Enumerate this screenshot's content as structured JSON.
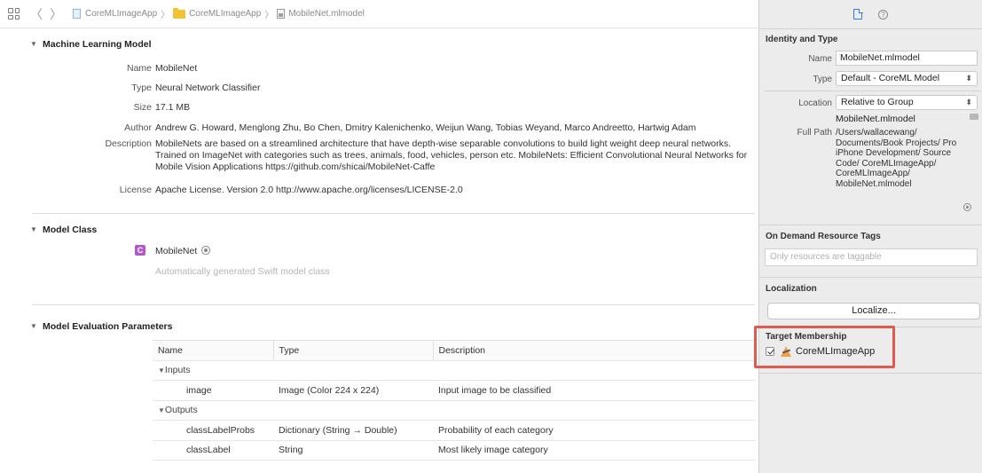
{
  "breadcrumb": {
    "items": [
      "CoreMLImageApp",
      "CoreMLImageApp",
      "MobileNet.mlmodel"
    ],
    "separator": "〉"
  },
  "nav": {
    "back": "〈",
    "forward": "〉"
  },
  "sections": {
    "machine_learning_model": {
      "title": "Machine Learning Model",
      "properties": [
        {
          "label": "Name",
          "value": "MobileNet"
        },
        {
          "label": "Type",
          "value": "Neural Network Classifier"
        },
        {
          "label": "Size",
          "value": "17.1 MB"
        },
        {
          "label": "Author",
          "value": "Andrew G. Howard, Menglong Zhu, Bo Chen, Dmitry Kalenichenko, Weijun Wang, Tobias Weyand, Marco Andreetto, Hartwig Adam"
        },
        {
          "label": "Description",
          "value": "MobileNets are based on a streamlined architecture that have depth-wise separable convolutions to build light weight deep neural networks. Trained on ImageNet with categories such as trees, animals, food, vehicles, person etc. MobileNets: Efficient Convolutional Neural Networks for Mobile Vision Applications https://github.com/shicai/MobileNet-Caffe"
        },
        {
          "label": "License",
          "value": "Apache License. Version 2.0 http://www.apache.org/licenses/LICENSE-2.0"
        }
      ]
    },
    "model_class": {
      "title": "Model Class",
      "badge": "C",
      "class_name": "MobileNet",
      "note": "Automatically generated Swift model class"
    },
    "model_evaluation": {
      "title": "Model Evaluation Parameters",
      "columns": [
        "Name",
        "Type",
        "Description"
      ],
      "groups": {
        "inputs": "Inputs",
        "outputs": "Outputs"
      },
      "inputs": [
        {
          "name": "image",
          "type": "Image (Color 224 x 224)",
          "description": "Input image to be classified"
        }
      ],
      "outputs": [
        {
          "name": "classLabelProbs",
          "type": "Dictionary (String → Double)",
          "description": "Probability of each category"
        },
        {
          "name": "classLabel",
          "type": "String",
          "description": "Most likely image category"
        }
      ]
    }
  },
  "inspector": {
    "help_glyph": "?",
    "identity": {
      "title": "Identity and Type",
      "name_label": "Name",
      "name_value": "MobileNet.mlmodel",
      "type_label": "Type",
      "type_value": "Default - CoreML Model",
      "location_label": "Location",
      "location_value": "Relative to Group",
      "filename": "MobileNet.mlmodel",
      "full_path_label": "Full Path",
      "full_path_value": "/Users/wallacewang/ Documents/Book Projects/ Pro iPhone Development/ Source Code/ CoreMLImageApp/ CoreMLImageApp/ MobileNet.mlmodel"
    },
    "on_demand": {
      "title": "On Demand Resource Tags",
      "placeholder": "Only resources are taggable"
    },
    "localization": {
      "title": "Localization",
      "button": "Localize..."
    },
    "target_membership": {
      "title": "Target Membership",
      "target": "CoreMLImageApp",
      "checked": true,
      "highlight_color": "#e05a4e"
    }
  }
}
